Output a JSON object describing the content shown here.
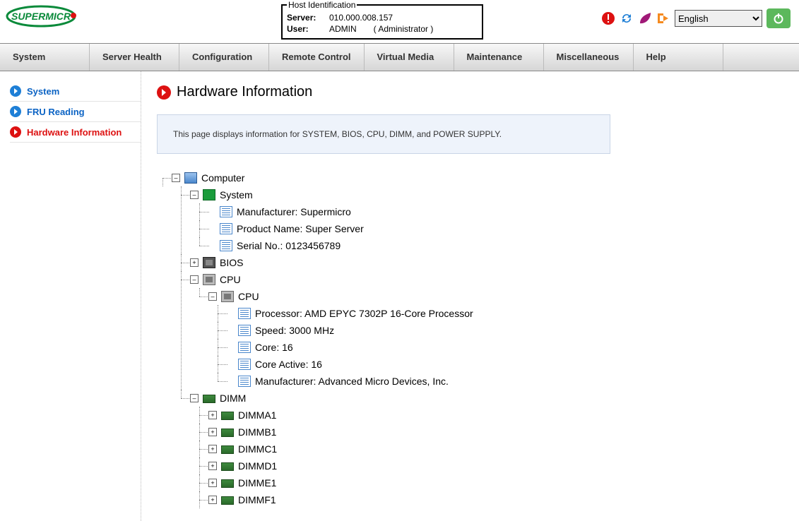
{
  "hostid": {
    "legend": "Host Identification",
    "server_label": "Server:",
    "server_value": "010.000.008.157",
    "user_label": "User:",
    "user_value": "ADMIN",
    "user_note": "( Administrator )"
  },
  "lang": {
    "selected": "English"
  },
  "nav": {
    "system": "System",
    "server_health": "Server Health",
    "configuration": "Configuration",
    "remote_control": "Remote Control",
    "virtual_media": "Virtual Media",
    "maintenance": "Maintenance",
    "miscellaneous": "Miscellaneous",
    "help": "Help"
  },
  "sidebar": {
    "system": "System",
    "fru": "FRU Reading",
    "hwinfo": "Hardware Information"
  },
  "page": {
    "title": "Hardware Information",
    "desc": "This page displays information for SYSTEM, BIOS, CPU, DIMM, and POWER SUPPLY."
  },
  "tree": {
    "computer": "Computer",
    "system": "System",
    "sys_manufacturer": "Manufacturer: Supermicro",
    "sys_product": "Product Name: Super Server",
    "sys_serial": "Serial No.: 0123456789",
    "bios": "BIOS",
    "cpu": "CPU",
    "cpu_sub": "CPU",
    "cpu_proc": "Processor: AMD EPYC 7302P 16-Core Processor",
    "cpu_speed": "Speed: 3000 MHz",
    "cpu_core": "Core: 16",
    "cpu_active": "Core Active: 16",
    "cpu_manu": "Manufacturer: Advanced Micro Devices, Inc.",
    "dimm": "DIMM",
    "dimm_a1": "DIMMA1",
    "dimm_b1": "DIMMB1",
    "dimm_c1": "DIMMC1",
    "dimm_d1": "DIMMD1",
    "dimm_e1": "DIMME1",
    "dimm_f1": "DIMMF1"
  }
}
